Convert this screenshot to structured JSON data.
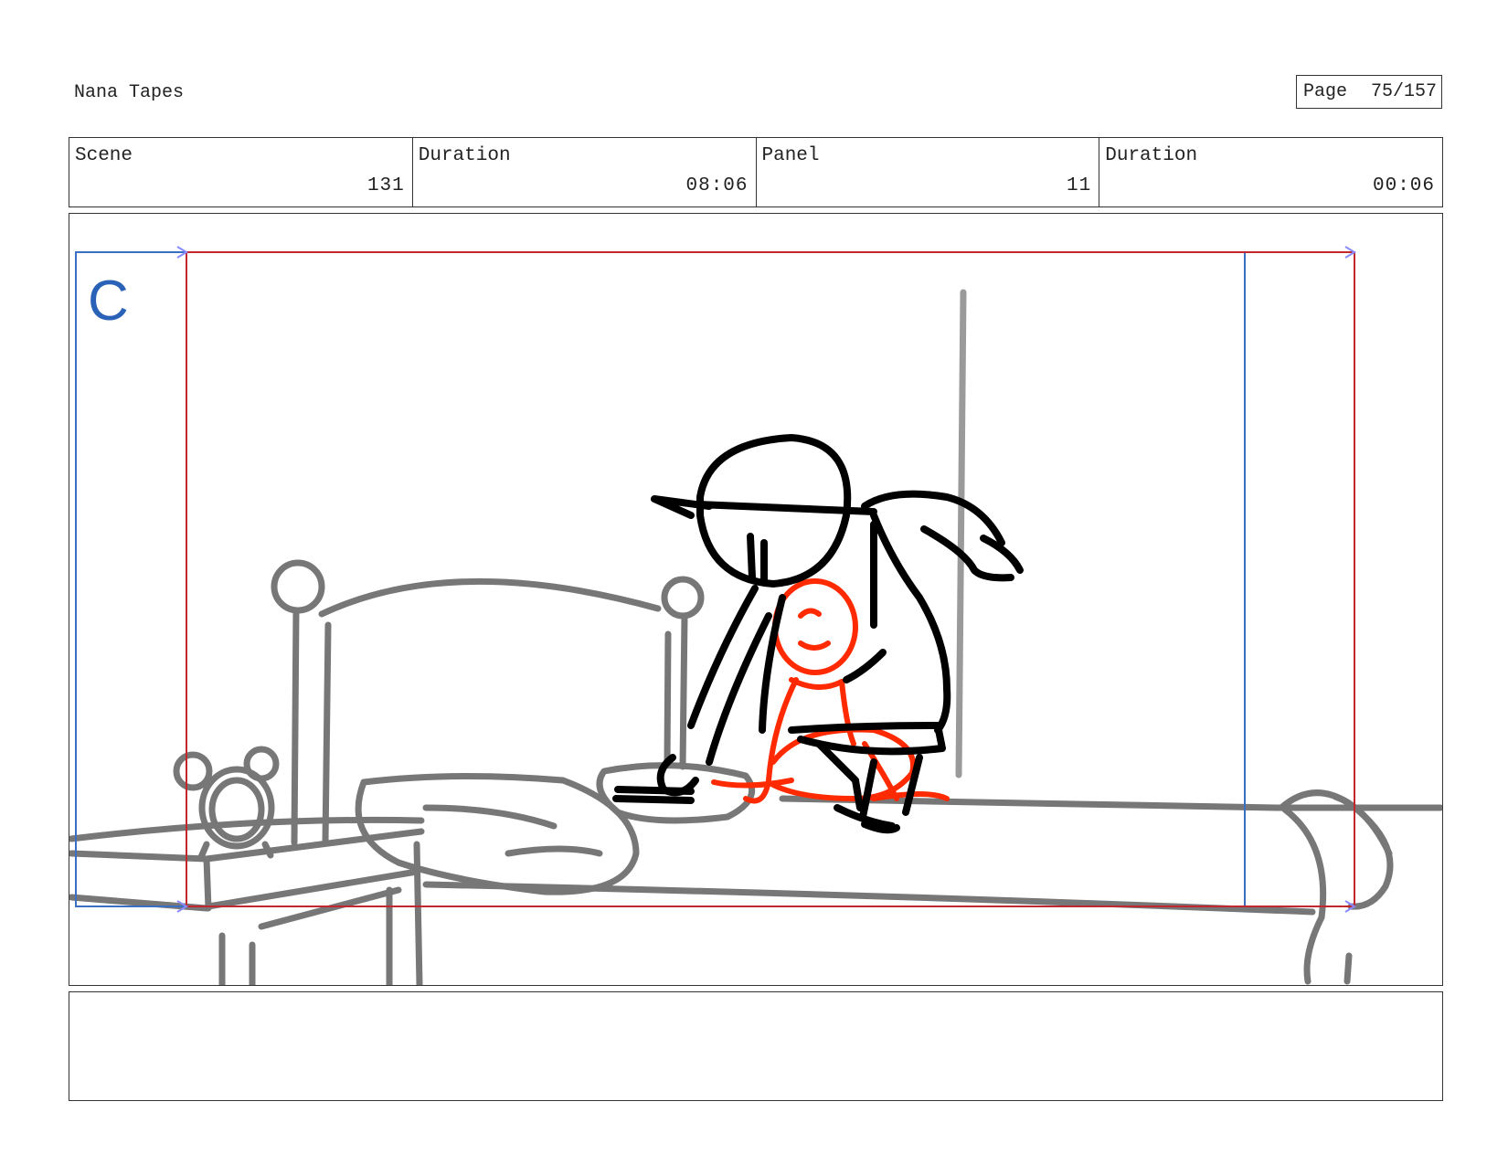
{
  "header": {
    "project_title": "Nana Tapes",
    "page_label": "Page",
    "page_number": "75/157"
  },
  "info": {
    "scene_label": "Scene",
    "scene_value": "131",
    "scene_duration_label": "Duration",
    "scene_duration_value": "08:06",
    "panel_label": "Panel",
    "panel_value": "11",
    "panel_duration_label": "Duration",
    "panel_duration_value": "00:06"
  },
  "panel": {
    "camera_label": "C",
    "colors": {
      "camera_frame": "#3a6fc4",
      "safe_frame": "#c0282d",
      "background_lines": "#777777",
      "character_lines": "#000000",
      "child_character": "#ff2a00"
    }
  },
  "notes": {
    "text": ""
  }
}
